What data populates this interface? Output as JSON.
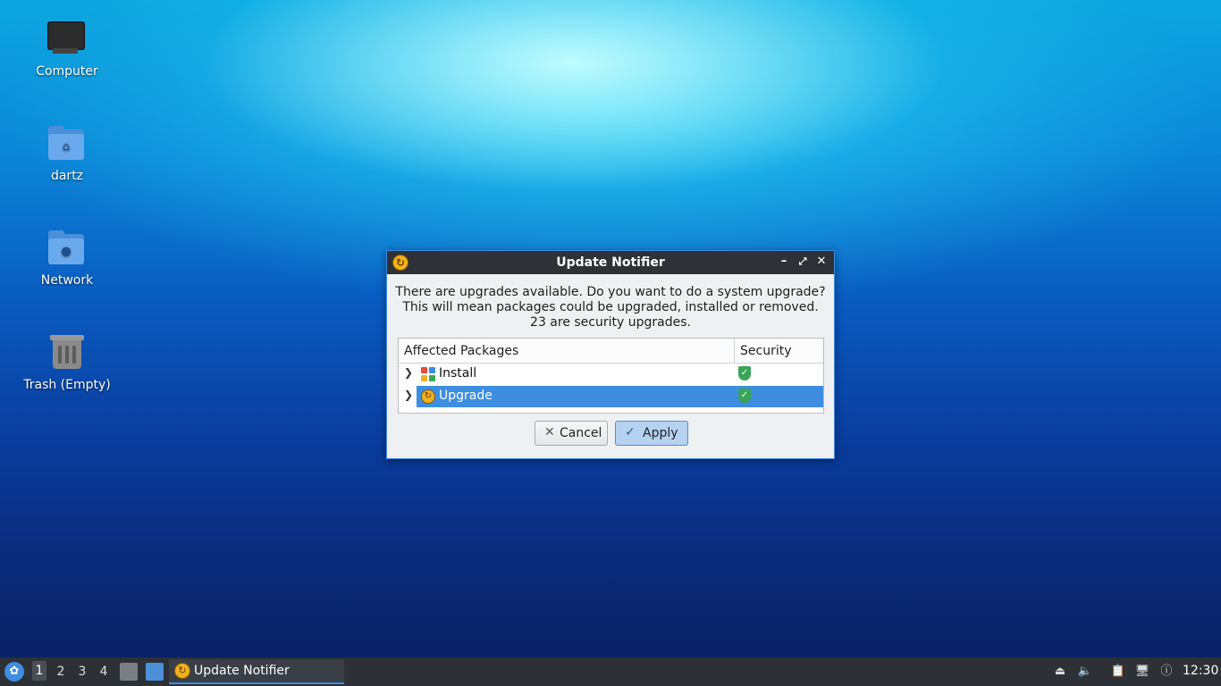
{
  "desktop": {
    "icons": [
      {
        "label": "Computer"
      },
      {
        "label": "dartz"
      },
      {
        "label": "Network"
      },
      {
        "label": "Trash (Empty)"
      }
    ]
  },
  "dialog": {
    "title": "Update Notifier",
    "message_line1": "There are upgrades available. Do you want to do a system upgrade?",
    "message_line2": "This will mean packages could be upgraded, installed or removed.",
    "message_line3": "23 are security upgrades.",
    "columns": {
      "packages": "Affected Packages",
      "security": "Security"
    },
    "rows": [
      {
        "label": "Install",
        "selected": false
      },
      {
        "label": "Upgrade",
        "selected": true
      }
    ],
    "cancel_label": "Cancel",
    "apply_label": "Apply"
  },
  "taskbar": {
    "workspaces": [
      "1",
      "2",
      "3",
      "4"
    ],
    "task_label": "Update Notifier",
    "clock": "12:30"
  },
  "colors": {
    "accent": "#3d8ee0",
    "titlebar": "#2e3136",
    "taskbar": "#2d3136",
    "security_ok": "#3aa557"
  }
}
